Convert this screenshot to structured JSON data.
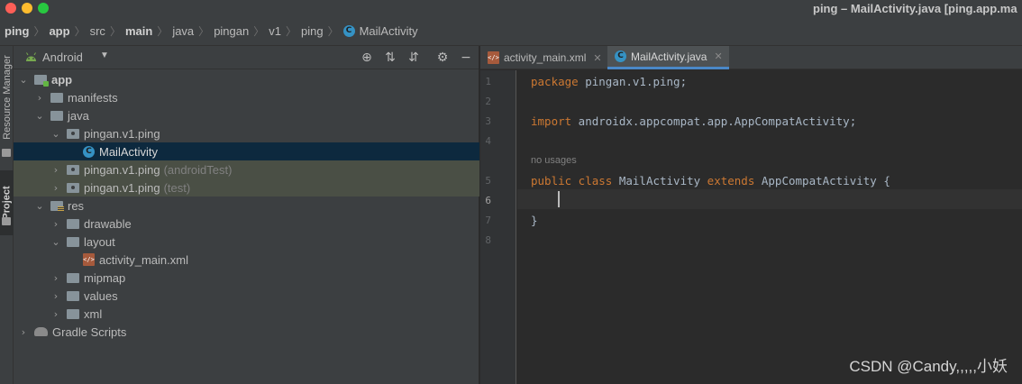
{
  "window": {
    "title": "ping – MailActivity.java [ping.app.ma"
  },
  "breadcrumb": [
    "ping",
    "app",
    "src",
    "main",
    "java",
    "pingan",
    "v1",
    "ping",
    "MailActivity"
  ],
  "left_strip": {
    "resource_manager": "Resource Manager",
    "project": "Project"
  },
  "project_panel": {
    "view": "Android",
    "tree": [
      {
        "label": "app",
        "bold": true,
        "icon": "module-folder-icon",
        "expanded": true
      },
      {
        "label": "manifests",
        "icon": "folder-icon",
        "expanded": false
      },
      {
        "label": "java",
        "icon": "folder-icon",
        "expanded": true
      },
      {
        "label": "pingan.v1.ping",
        "icon": "package-icon",
        "expanded": true
      },
      {
        "label": "MailActivity",
        "icon": "class-icon",
        "selected": true
      },
      {
        "label": "pingan.v1.ping",
        "suffix": "(androidTest)",
        "icon": "package-icon",
        "expanded": false
      },
      {
        "label": "pingan.v1.ping",
        "suffix": "(test)",
        "icon": "package-icon",
        "expanded": false
      },
      {
        "label": "res",
        "icon": "res-folder-icon",
        "expanded": true
      },
      {
        "label": "drawable",
        "icon": "folder-icon",
        "expanded": false
      },
      {
        "label": "layout",
        "icon": "folder-icon",
        "expanded": true
      },
      {
        "label": "activity_main.xml",
        "icon": "xml-file-icon"
      },
      {
        "label": "mipmap",
        "icon": "folder-icon",
        "expanded": false
      },
      {
        "label": "values",
        "icon": "folder-icon",
        "expanded": false
      },
      {
        "label": "xml",
        "icon": "folder-icon",
        "expanded": false
      },
      {
        "label": "Gradle Scripts",
        "icon": "gradle-icon",
        "expanded": false
      }
    ]
  },
  "editor": {
    "tabs": [
      {
        "label": "activity_main.xml",
        "active": false
      },
      {
        "label": "MailActivity.java",
        "active": true
      }
    ],
    "line_numbers": [
      "1",
      "2",
      "3",
      "4",
      "5",
      "6",
      "7",
      "8"
    ],
    "usage_hint": "no usages",
    "code": {
      "l1_kw": "package",
      "l1_rest": " pingan.v1.ping;",
      "l3_kw": "import",
      "l3_rest": " androidx.appcompat.app.AppCompatActivity;",
      "l5_kw1": "public class",
      "l5_mid": " MailActivity ",
      "l5_kw2": "extends",
      "l5_rest": " AppCompatActivity {",
      "l7": "}"
    },
    "current_line": "6"
  },
  "watermark": "CSDN @Candy,,,,,小妖",
  "colors": {
    "keyword": "#cc7832",
    "code_text": "#a9b7c6",
    "selection": "#0d293e",
    "tab_underline": "#4a88c7"
  }
}
